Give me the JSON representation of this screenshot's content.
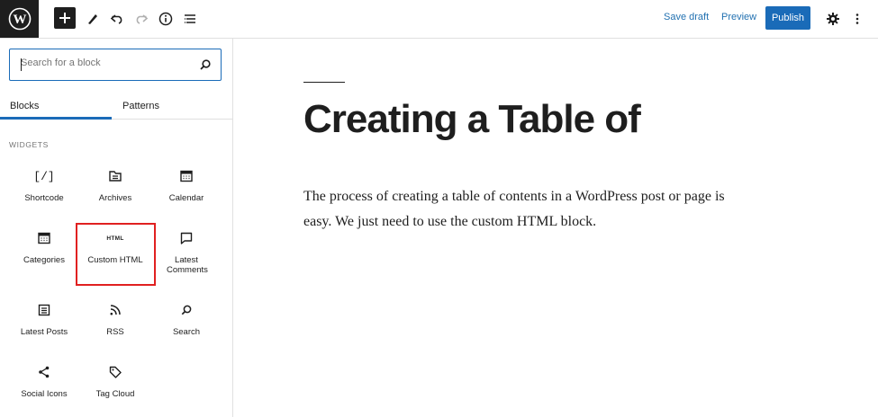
{
  "toolbar": {
    "save_draft": "Save draft",
    "preview": "Preview",
    "publish": "Publish",
    "icons": [
      "wordpress-icon",
      "plus-icon",
      "pencil-icon",
      "undo-icon",
      "redo-icon",
      "info-icon",
      "list-view-icon",
      "gear-icon",
      "more-vertical-icon"
    ]
  },
  "inserter": {
    "search_placeholder": "Search for a block",
    "tabs": [
      {
        "label": "Blocks",
        "active": true
      },
      {
        "label": "Patterns",
        "active": false
      }
    ],
    "section_title": "WIDGETS",
    "blocks": [
      {
        "label": "Shortcode",
        "icon": "shortcode-icon"
      },
      {
        "label": "Archives",
        "icon": "archives-icon"
      },
      {
        "label": "Calendar",
        "icon": "calendar-icon"
      },
      {
        "label": "Categories",
        "icon": "categories-icon"
      },
      {
        "label": "Custom HTML",
        "icon": "html-icon",
        "icon_text": "HTML",
        "highlighted": true
      },
      {
        "label": "Latest Comments",
        "icon": "comment-icon"
      },
      {
        "label": "Latest Posts",
        "icon": "posts-list-icon"
      },
      {
        "label": "RSS",
        "icon": "rss-icon"
      },
      {
        "label": "Search",
        "icon": "search-icon"
      },
      {
        "label": "Social Icons",
        "icon": "share-icon"
      },
      {
        "label": "Tag Cloud",
        "icon": "tag-icon"
      }
    ]
  },
  "post": {
    "title": "Creating a Table of",
    "body": "The process of creating a table of contents in a WordPress post or page is easy. We just need to use the custom HTML block."
  },
  "colors": {
    "accent": "#1a6bb8",
    "highlight": "#e02020",
    "dark": "#1e1e1e"
  }
}
